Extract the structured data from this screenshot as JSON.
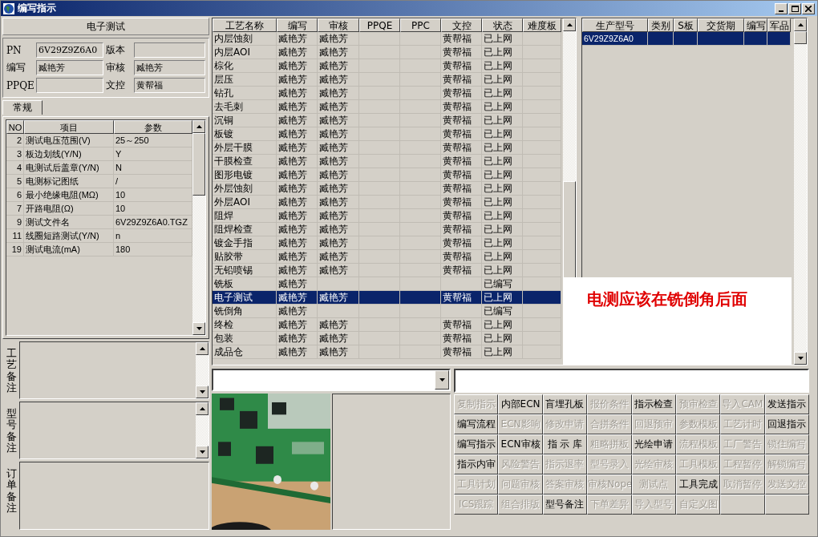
{
  "window": {
    "title": "编写指示"
  },
  "process_header": "电子测试",
  "info": {
    "pn_label": "PN",
    "pn": "6V29Z9Z6A0",
    "version_label": "版本",
    "writer_label": "编写",
    "writer": "臧艳芳",
    "reviewer_label": "审核",
    "reviewer": "臧艳芳",
    "ppqe_label": "PPQE",
    "doc_control_label": "文控",
    "doc_control": "黄帮福"
  },
  "tabs": [
    {
      "label": "常规",
      "selected": true
    }
  ],
  "params": {
    "columns": [
      "NO",
      "项目",
      "参数"
    ],
    "rows": [
      {
        "no": "2",
        "item": "测试电压范围(V)",
        "value": "25～250"
      },
      {
        "no": "3",
        "item": "板边划线(Y/N)",
        "value": "Y"
      },
      {
        "no": "4",
        "item": "电测试后盖章(Y/N)",
        "value": "N"
      },
      {
        "no": "5",
        "item": "电测标记图纸",
        "value": "/"
      },
      {
        "no": "6",
        "item": "最小绝缘电阻(MΩ)",
        "value": "10"
      },
      {
        "no": "7",
        "item": "开路电阻(Ω)",
        "value": "10"
      },
      {
        "no": "9",
        "item": "测试文件名",
        "value": "6V29Z9Z6A0.TGZ"
      },
      {
        "no": "11",
        "item": "线圈短路测试(Y/N)",
        "value": "n"
      },
      {
        "no": "19",
        "item": "测试电流(mA)",
        "value": "180"
      }
    ]
  },
  "notes": [
    {
      "label": "工艺备注",
      "kind": "scroll"
    },
    {
      "label": "型号备注",
      "kind": "scroll"
    },
    {
      "label": "订单备注",
      "kind": "plain"
    }
  ],
  "process_table": {
    "columns": [
      "工艺名称",
      "编写",
      "审核",
      "PPQE",
      "PPC",
      "文控",
      "状态",
      "难度板"
    ],
    "rows": [
      {
        "name": "内层蚀刻",
        "writer": "臧艳芳",
        "reviewer": "臧艳芳",
        "doc_control": "黄帮福",
        "status": "已上网",
        "selected": false
      },
      {
        "name": "内层AOI",
        "writer": "臧艳芳",
        "reviewer": "臧艳芳",
        "doc_control": "黄帮福",
        "status": "已上网",
        "selected": false
      },
      {
        "name": "棕化",
        "writer": "臧艳芳",
        "reviewer": "臧艳芳",
        "doc_control": "黄帮福",
        "status": "已上网",
        "selected": false
      },
      {
        "name": "层压",
        "writer": "臧艳芳",
        "reviewer": "臧艳芳",
        "doc_control": "黄帮福",
        "status": "已上网",
        "selected": false
      },
      {
        "name": "钻孔",
        "writer": "臧艳芳",
        "reviewer": "臧艳芳",
        "doc_control": "黄帮福",
        "status": "已上网",
        "selected": false
      },
      {
        "name": "去毛刺",
        "writer": "臧艳芳",
        "reviewer": "臧艳芳",
        "doc_control": "黄帮福",
        "status": "已上网",
        "selected": false
      },
      {
        "name": "沉铜",
        "writer": "臧艳芳",
        "reviewer": "臧艳芳",
        "doc_control": "黄帮福",
        "status": "已上网",
        "selected": false
      },
      {
        "name": "板镀",
        "writer": "臧艳芳",
        "reviewer": "臧艳芳",
        "doc_control": "黄帮福",
        "status": "已上网",
        "selected": false
      },
      {
        "name": "外层干膜",
        "writer": "臧艳芳",
        "reviewer": "臧艳芳",
        "doc_control": "黄帮福",
        "status": "已上网",
        "selected": false
      },
      {
        "name": "干膜检查",
        "writer": "臧艳芳",
        "reviewer": "臧艳芳",
        "doc_control": "黄帮福",
        "status": "已上网",
        "selected": false
      },
      {
        "name": "图形电镀",
        "writer": "臧艳芳",
        "reviewer": "臧艳芳",
        "doc_control": "黄帮福",
        "status": "已上网",
        "selected": false
      },
      {
        "name": "外层蚀刻",
        "writer": "臧艳芳",
        "reviewer": "臧艳芳",
        "doc_control": "黄帮福",
        "status": "已上网",
        "selected": false
      },
      {
        "name": "外层AOI",
        "writer": "臧艳芳",
        "reviewer": "臧艳芳",
        "doc_control": "黄帮福",
        "status": "已上网",
        "selected": false
      },
      {
        "name": "阻焊",
        "writer": "臧艳芳",
        "reviewer": "臧艳芳",
        "doc_control": "黄帮福",
        "status": "已上网",
        "selected": false
      },
      {
        "name": "阻焊检查",
        "writer": "臧艳芳",
        "reviewer": "臧艳芳",
        "doc_control": "黄帮福",
        "status": "已上网",
        "selected": false
      },
      {
        "name": "镀金手指",
        "writer": "臧艳芳",
        "reviewer": "臧艳芳",
        "doc_control": "黄帮福",
        "status": "已上网",
        "selected": false
      },
      {
        "name": "贴胶带",
        "writer": "臧艳芳",
        "reviewer": "臧艳芳",
        "doc_control": "黄帮福",
        "status": "已上网",
        "selected": false
      },
      {
        "name": "无铅喷锡",
        "writer": "臧艳芳",
        "reviewer": "臧艳芳",
        "doc_control": "黄帮福",
        "status": "已上网",
        "selected": false
      },
      {
        "name": "铣板",
        "writer": "臧艳芳",
        "status": "已编写",
        "selected": false
      },
      {
        "name": "电子测试",
        "writer": "臧艳芳",
        "reviewer": "臧艳芳",
        "doc_control": "黄帮福",
        "status": "已上网",
        "selected": true
      },
      {
        "name": "铣倒角",
        "writer": "臧艳芳",
        "status": "已编写",
        "selected": false
      },
      {
        "name": "终检",
        "writer": "臧艳芳",
        "reviewer": "臧艳芳",
        "doc_control": "黄帮福",
        "status": "已上网",
        "selected": false
      },
      {
        "name": "包装",
        "writer": "臧艳芳",
        "reviewer": "臧艳芳",
        "doc_control": "黄帮福",
        "status": "已上网",
        "selected": false
      },
      {
        "name": "成品仓",
        "writer": "臧艳芳",
        "reviewer": "臧艳芳",
        "doc_control": "黄帮福",
        "status": "已上网",
        "selected": false
      }
    ]
  },
  "model_table": {
    "columns": [
      "生产型号",
      "类别",
      "S板",
      "交货期",
      "编写",
      "军品"
    ],
    "rows": [
      {
        "model": "6V29Z9Z6A0",
        "selected": true
      }
    ]
  },
  "annotation": "电测应该在铣倒角后面",
  "buttons": [
    {
      "label": "复制指示",
      "enabled": false
    },
    {
      "label": "内部ECN",
      "enabled": true
    },
    {
      "label": "盲埋孔板",
      "enabled": true
    },
    {
      "label": "报价条件",
      "enabled": false
    },
    {
      "label": "指示检查",
      "enabled": true
    },
    {
      "label": "预审检查",
      "enabled": false
    },
    {
      "label": "导入CAM",
      "enabled": false
    },
    {
      "label": "发送指示",
      "enabled": true
    },
    {
      "label": "编写流程",
      "enabled": true
    },
    {
      "label": "ECN影响",
      "enabled": false
    },
    {
      "label": "修改申请",
      "enabled": false
    },
    {
      "label": "合拼条件",
      "enabled": false
    },
    {
      "label": "回退预审",
      "enabled": false
    },
    {
      "label": "参数模板",
      "enabled": false
    },
    {
      "label": "工艺计时",
      "enabled": false
    },
    {
      "label": "回退指示",
      "enabled": true
    },
    {
      "label": "编写指示",
      "enabled": true
    },
    {
      "label": "ECN审核",
      "enabled": true
    },
    {
      "label": "指 示 库",
      "enabled": true
    },
    {
      "label": "粗略拼板",
      "enabled": false
    },
    {
      "label": "光绘申请",
      "enabled": true
    },
    {
      "label": "流程模板",
      "enabled": false
    },
    {
      "label": "工厂警告",
      "enabled": false
    },
    {
      "label": "锁住编写",
      "enabled": false
    },
    {
      "label": "指示内审",
      "enabled": true
    },
    {
      "label": "风险警告",
      "enabled": false
    },
    {
      "label": "指示退率",
      "enabled": false
    },
    {
      "label": "型号录入",
      "enabled": false
    },
    {
      "label": "光绘审核",
      "enabled": false
    },
    {
      "label": "工具模板",
      "enabled": false
    },
    {
      "label": "工程暂停",
      "enabled": false
    },
    {
      "label": "解锁编写",
      "enabled": false
    },
    {
      "label": "工具计划",
      "enabled": false
    },
    {
      "label": "问题审核",
      "enabled": false
    },
    {
      "label": "答案审核",
      "enabled": false
    },
    {
      "label": "审核Nope",
      "enabled": false
    },
    {
      "label": "测试点",
      "enabled": false
    },
    {
      "label": "工具完成",
      "enabled": true
    },
    {
      "label": "取消暂停",
      "enabled": false
    },
    {
      "label": "发送文控",
      "enabled": false
    },
    {
      "label": "ICS跟踪",
      "enabled": false
    },
    {
      "label": "组合排版",
      "enabled": false
    },
    {
      "label": "型号备注",
      "enabled": true
    },
    {
      "label": "下单差异",
      "enabled": false
    },
    {
      "label": "导入型号",
      "enabled": false
    },
    {
      "label": "自定义图",
      "enabled": false
    }
  ]
}
